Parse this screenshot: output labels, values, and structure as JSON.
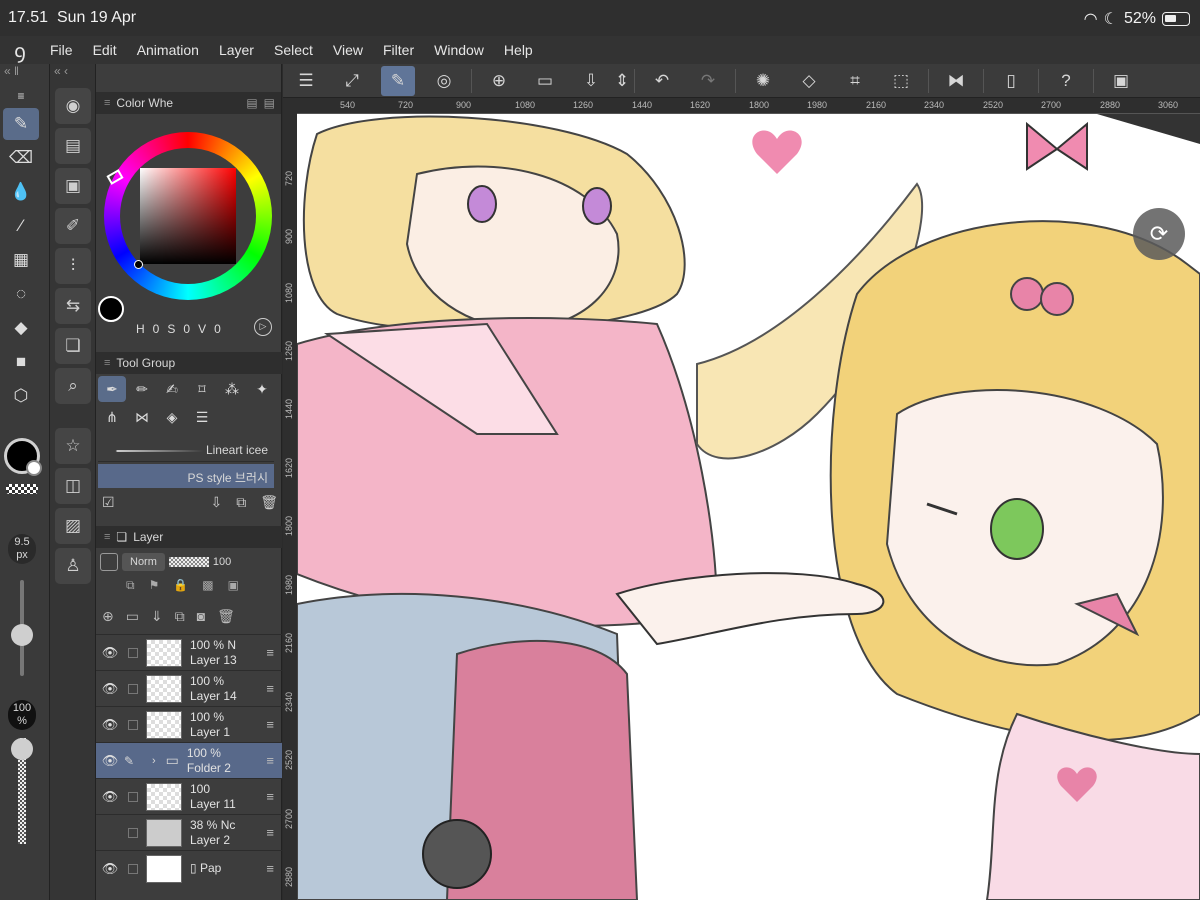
{
  "status": {
    "time": "17.51",
    "date": "Sun 19 Apr",
    "battery": "52%",
    "battery_level": 0.52
  },
  "menu": [
    "File",
    "Edit",
    "Animation",
    "Layer",
    "Select",
    "View",
    "Filter",
    "Window",
    "Help"
  ],
  "color_panel": {
    "title": "Color Whe",
    "hsv": {
      "h_label": "H",
      "h": "0",
      "s_label": "S",
      "s": "0",
      "v_label": "V",
      "v": "0"
    }
  },
  "tool_group": {
    "title": "Tool Group",
    "brushes": [
      "Lineart icee",
      "PS style 브러시"
    ]
  },
  "brush_size": {
    "value": "9.5",
    "unit": "px"
  },
  "opacity": {
    "value": "100",
    "unit": "%"
  },
  "layer_panel": {
    "title": "Layer",
    "blend_mode": "Norm",
    "opacity_value": "100",
    "layers": [
      {
        "opacity": "100 %",
        "name": "Layer 13",
        "extra": "N",
        "selected": false
      },
      {
        "opacity": "100 %",
        "name": "Layer 14",
        "extra": "",
        "selected": false
      },
      {
        "opacity": "100 %",
        "name": "Layer 1",
        "extra": "",
        "selected": false
      },
      {
        "opacity": "100 %",
        "name": "Folder 2",
        "extra": "",
        "selected": true
      },
      {
        "opacity": "100",
        "name": "Layer 11",
        "extra": "",
        "selected": false
      },
      {
        "opacity": "38 %",
        "name": "Layer 2",
        "extra": "Nc",
        "selected": false
      },
      {
        "opacity": "",
        "name": "Pap",
        "extra": "",
        "selected": false
      }
    ]
  },
  "ruler_top": [
    "540",
    "720",
    "900",
    "1080",
    "1260",
    "1440",
    "1620",
    "1800",
    "1980",
    "2160",
    "2340",
    "2520",
    "2700",
    "2880",
    "3060"
  ],
  "ruler_left": [
    "720",
    "900",
    "1080",
    "1260",
    "1440",
    "1620",
    "1800",
    "1980",
    "2160",
    "2340",
    "2520",
    "2700",
    "2880"
  ],
  "colors": {
    "accent": "#607598",
    "main_color": "#000000",
    "sub_color": "#ffffff"
  }
}
